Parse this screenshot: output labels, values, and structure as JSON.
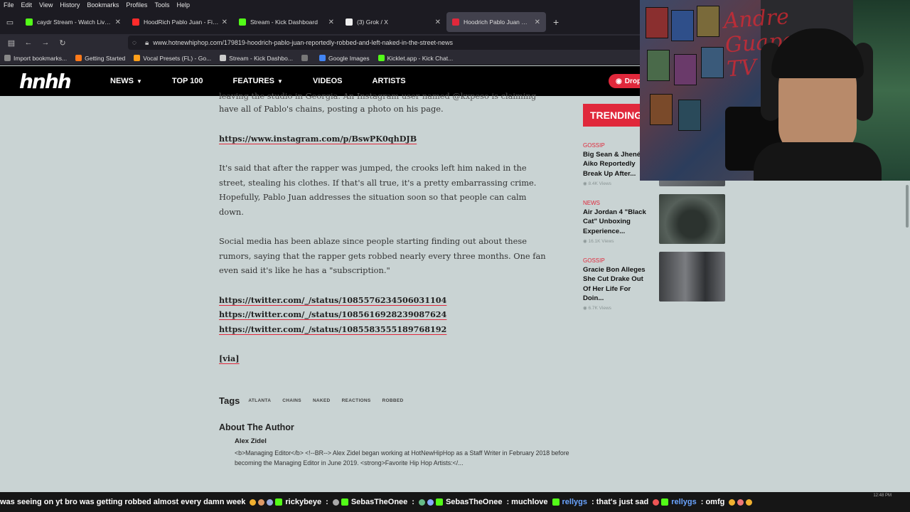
{
  "menubar": {
    "items": [
      "File",
      "Edit",
      "View",
      "History",
      "Bookmarks",
      "Profiles",
      "Tools",
      "Help"
    ]
  },
  "tabs": [
    {
      "label": "caydr Stream - Watch Live on Kick",
      "color": "#53fc18",
      "active": false
    },
    {
      "label": "HoodRich Pablo Juan - First Day",
      "color": "#ff2b2b",
      "active": false
    },
    {
      "label": "Stream - Kick Dashboard",
      "color": "#53fc18",
      "active": false
    },
    {
      "label": "(3) Grok / X",
      "color": "#eeeeee",
      "active": false
    },
    {
      "label": "Hoodrich Pablo Juan Reportedly",
      "color": "#e0283b",
      "active": true
    }
  ],
  "address": {
    "url": "www.hotnewhiphop.com/179819-hoodrich-pablo-juan-reportedly-robbed-and-left-naked-in-the-street-news"
  },
  "bookmarks": [
    {
      "label": "Import bookmarks...",
      "color": "#888888"
    },
    {
      "label": "Getting Started",
      "color": "#ff7a1a"
    },
    {
      "label": "Vocal Presets (FL) - Go...",
      "color": "#ff9f1a"
    },
    {
      "label": "Stream - Kick Dashbo...",
      "color": "#cccccc"
    },
    {
      "label": "",
      "color": "#777777"
    },
    {
      "label": "Google Images",
      "color": "#4285f4"
    },
    {
      "label": "Kicklet.app - Kick Chat...",
      "color": "#53fc18"
    }
  ],
  "site": {
    "logo": "hnhh",
    "nav": [
      "NEWS",
      "TOP 100",
      "FEATURES",
      "VIDEOS",
      "ARTISTS"
    ],
    "drop_label": "Drop"
  },
  "article": {
    "cut_line": "leaving the studio in Georgia. An Instagram user named @kxpeso is claiming to",
    "p1_line2": "have all of Pablo's chains, posting a photo on his page.",
    "ig_link": "https://www.instagram.com/p/BswPK0qhDJB",
    "p2": "It's said that after the rapper was jumped, the crooks left him naked in the street, stealing his clothes. If that's all true, it's a pretty embarrassing crime. Hopefully, Pablo Juan addresses the situation soon so that people can calm down.",
    "p3": "Social media has been ablaze since people starting finding out about these rumors, saying that the rapper gets robbed nearly every three months. One fan even said it's like he has a \"subscription.\"",
    "twitter_links": [
      "https://twitter.com/_/status/1085576234506031104",
      "https://twitter.com/_/status/1085616928239087624",
      "https://twitter.com/_/status/1085583555189768192"
    ],
    "via": "[via]"
  },
  "tags": {
    "title": "Tags",
    "items": [
      "ATLANTA",
      "CHAINS",
      "NAKED",
      "REACTIONS",
      "ROBBED"
    ]
  },
  "author": {
    "title": "About The Author",
    "name": "Alex Zidel",
    "bio": "<b>Managing Editor</b> <!--BR--> Alex Zidel began working at HotNewHipHop as a Staff Writer in February 2018 before becoming the Managing Editor in June 2019. <strong>Favorite Hip Hop Artists:</..."
  },
  "trending": {
    "title": "TRENDING",
    "items": [
      {
        "category": "GOSSIP",
        "title": "Big Sean & Jhené Aiko Reportedly Break Up After...",
        "views": "8.4K Views",
        "thumb_color": "#6a6f74"
      },
      {
        "category": "NEWS",
        "title": "Air Jordan 4 \"Black Cat\" Unboxing Experience...",
        "views": "16.1K Views",
        "thumb_color": "#3f4742"
      },
      {
        "category": "GOSSIP",
        "title": "Gracie Bon Alleges She Cut Drake Out Of Her Life For Doin...",
        "views": "6.7K Views",
        "thumb_color": "#5a5a5e"
      }
    ]
  },
  "webcam": {
    "overlay_text": "Andre\nGuapo\nTV"
  },
  "chat_ticker": {
    "segments": [
      {
        "type": "text",
        "value": "was seeing on yt bro was getting robbed almost every damn week"
      },
      {
        "type": "user",
        "value": "rickybeye"
      },
      {
        "type": "text",
        "value": ":"
      },
      {
        "type": "user",
        "value": "SebasTheOnee"
      },
      {
        "type": "text",
        "value": ":"
      },
      {
        "type": "user",
        "value": "SebasTheOnee"
      },
      {
        "type": "text",
        "value": ": muchlove"
      },
      {
        "type": "user2",
        "value": "rellygs"
      },
      {
        "type": "text",
        "value": ": that's just sad"
      },
      {
        "type": "user2",
        "value": "rellygs"
      },
      {
        "type": "text",
        "value": ": omfg"
      }
    ],
    "time": "12:48 PM"
  }
}
